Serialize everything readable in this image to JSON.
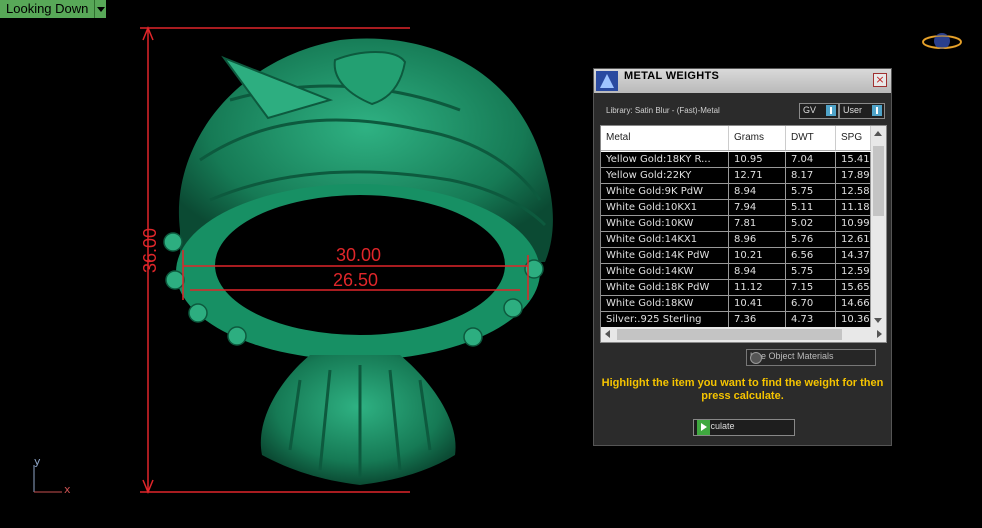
{
  "viewport": {
    "view_label": "Looking Down",
    "dimensions": {
      "height": "36.00",
      "outer_width": "30.00",
      "inner_width": "26.50"
    },
    "axis": {
      "y": "y",
      "x": "x"
    }
  },
  "panel": {
    "title": "METAL WEIGHTS",
    "library_label": "Library: Satin Blur - (Fast)-Metal",
    "gv_label": "GV",
    "user_label": "User",
    "columns": [
      "Metal",
      "Grams",
      "DWT",
      "SPG"
    ],
    "rows": [
      [
        "Yellow Gold:18KY R...",
        "10.95",
        "7.04",
        "15.41"
      ],
      [
        "Yellow Gold:22KY",
        "12.71",
        "8.17",
        "17.89"
      ],
      [
        "White Gold:9K PdW",
        "8.94",
        "5.75",
        "12.58"
      ],
      [
        "White Gold:10KX1",
        "7.94",
        "5.11",
        "11.18"
      ],
      [
        "White Gold:10KW",
        "7.81",
        "5.02",
        "10.99"
      ],
      [
        "White Gold:14KX1",
        "8.96",
        "5.76",
        "12.61"
      ],
      [
        "White Gold:14K PdW",
        "10.21",
        "6.56",
        "14.37"
      ],
      [
        "White Gold:14KW",
        "8.94",
        "5.75",
        "12.59"
      ],
      [
        "White Gold:18K PdW",
        "11.12",
        "7.15",
        "15.65"
      ],
      [
        "White Gold:18KW",
        "10.41",
        "6.70",
        "14.66"
      ],
      [
        "Silver:.925 Sterling",
        "7.36",
        "4.73",
        "10.36"
      ]
    ],
    "use_object_materials": "Use Object Materials",
    "hint": "Highlight the item you want to find the weight for then press calculate.",
    "calculate_label": "Calculate"
  },
  "colors": {
    "ring": "#1e8a62",
    "dimension": "#e0262a",
    "hint": "#f5c400"
  }
}
